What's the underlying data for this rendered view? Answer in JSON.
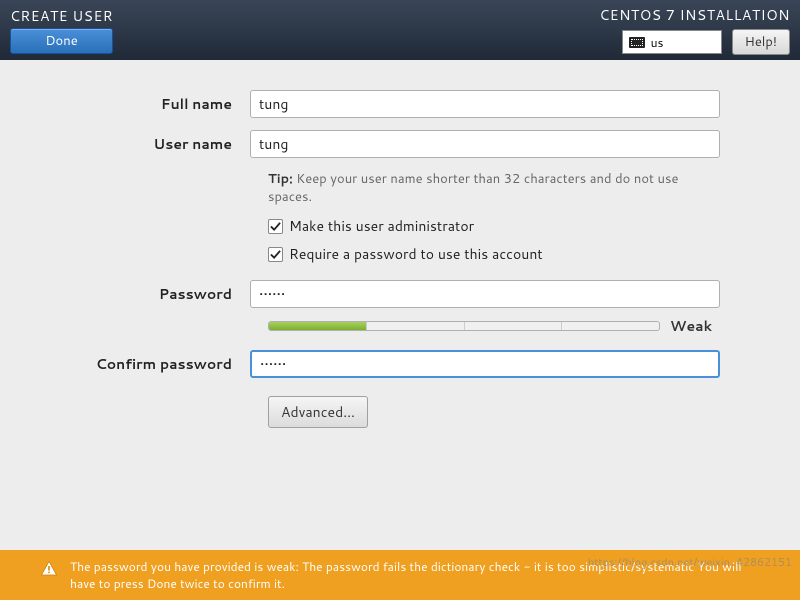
{
  "header": {
    "page_title": "CREATE USER",
    "done_label": "Done",
    "install_title": "CENTOS 7 INSTALLATION",
    "keyboard_layout": "us",
    "help_label": "Help!"
  },
  "form": {
    "fullname": {
      "label": "Full name",
      "value": "tung"
    },
    "username": {
      "label": "User name",
      "value": "tung"
    },
    "tip_prefix": "Tip:",
    "tip_text": "Keep your user name shorter than 32 characters and do not use spaces.",
    "admin_checkbox": {
      "label": "Make this user administrator",
      "checked": true
    },
    "require_pw_checkbox": {
      "label": "Require a password to use this account",
      "checked": true
    },
    "password": {
      "label": "Password",
      "value": "••••••"
    },
    "strength": {
      "level": 1,
      "segments": 4,
      "label": "Weak"
    },
    "confirm": {
      "label": "Confirm password",
      "value": "••••••"
    },
    "advanced_label": "Advanced..."
  },
  "footer": {
    "warning": "The password you have provided is weak: The password fails the dictionary check - it is too simplistic/systematic You will have to press Done twice to confirm it."
  },
  "watermark": "https://blog.csdn.net/weixin_42862151"
}
